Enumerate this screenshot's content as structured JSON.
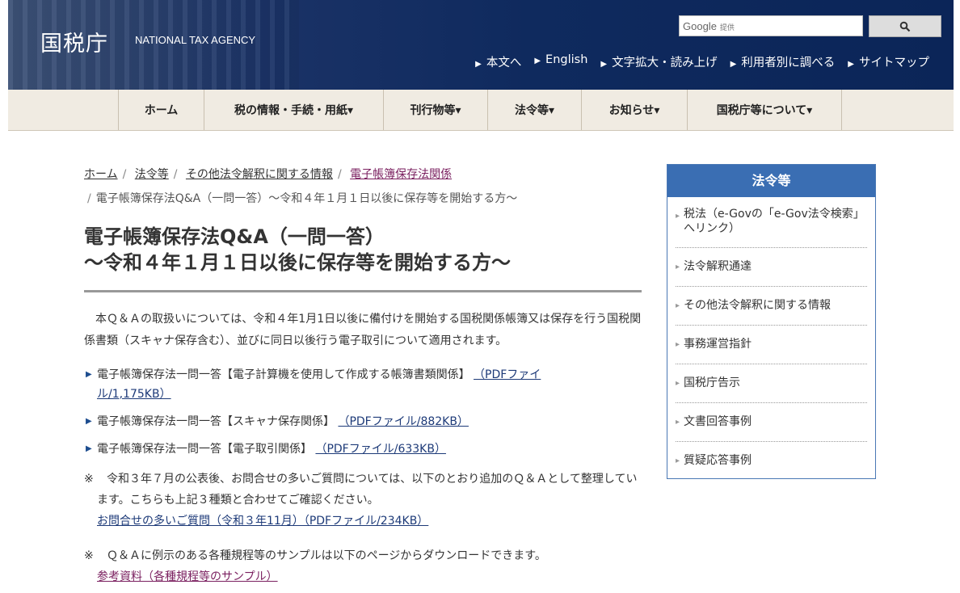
{
  "header": {
    "logo_jp": "国税庁",
    "logo_en": "NATIONAL TAX AGENCY",
    "search_brand": "Google",
    "search_provided": "提供",
    "search_icon": "search-icon",
    "utility_links": [
      "本文へ",
      "English",
      "文字拡大・読み上げ",
      "利用者別に調べる",
      "サイトマップ"
    ]
  },
  "nav": {
    "items": [
      "ホーム",
      "税の情報・手続・用紙▾",
      "刊行物等▾",
      "法令等▾",
      "お知らせ▾",
      "国税庁等について▾"
    ]
  },
  "breadcrumb": {
    "items": [
      "ホーム",
      "法令等",
      "その他法令解釈に関する情報",
      "電子帳簿保存法関係"
    ],
    "current": "電子帳簿保存法Q&A（一問一答）～令和４年１月１日以後に保存等を開始する方～"
  },
  "main": {
    "title_line1": "電子帳簿保存法Q&A（一問一答）",
    "title_line2": "～令和４年１月１日以後に保存等を開始する方～",
    "intro": "本Ｑ＆Ａの取扱いについては、令和４年1月1日以後に備付けを開始する国税関係帳簿又は保存を行う国税関係書類（スキャナ保存含む）、並びに同日以後行う電子取引について適用されます。",
    "links": [
      {
        "text": "電子帳簿保存法一問一答【電子計算機を使用して作成する帳簿書類関係】",
        "link": "（PDFファイル/1,175KB）"
      },
      {
        "text": "電子帳簿保存法一問一答【スキャナ保存関係】",
        "link": "（PDFファイル/882KB）"
      },
      {
        "text": "電子帳簿保存法一問一答【電子取引関係】",
        "link": "（PDFファイル/633KB）"
      }
    ],
    "note1_mark": "※",
    "note1_text": "令和３年７月の公表後、お問合せの多いご質問については、以下のとおり追加のＱ＆Ａとして整理しています。こちらも上記３種類と合わせてご確認ください。",
    "note1_link": "お問合せの多いご質問（令和３年11月）（PDFファイル/234KB）",
    "note2_mark": "※",
    "note2_text": "Ｑ＆Ａに例示のある各種規程等のサンプルは以下のページからダウンロードできます。",
    "note2_link": "参考資料（各種規程等のサンプル）"
  },
  "sidebar": {
    "title": "法令等",
    "items": [
      "税法（e-Govの「e-Gov法令検索」へリンク）",
      "法令解釈通達",
      "その他法令解釈に関する情報",
      "事務運営指針",
      "国税庁告示",
      "文書回答事例",
      "質疑応答事例"
    ]
  },
  "colors": {
    "header": "#0f2a5e",
    "nav": "#f0ebe2",
    "side_header": "#3a6eb3",
    "visited_link": "#7a1f5f"
  }
}
